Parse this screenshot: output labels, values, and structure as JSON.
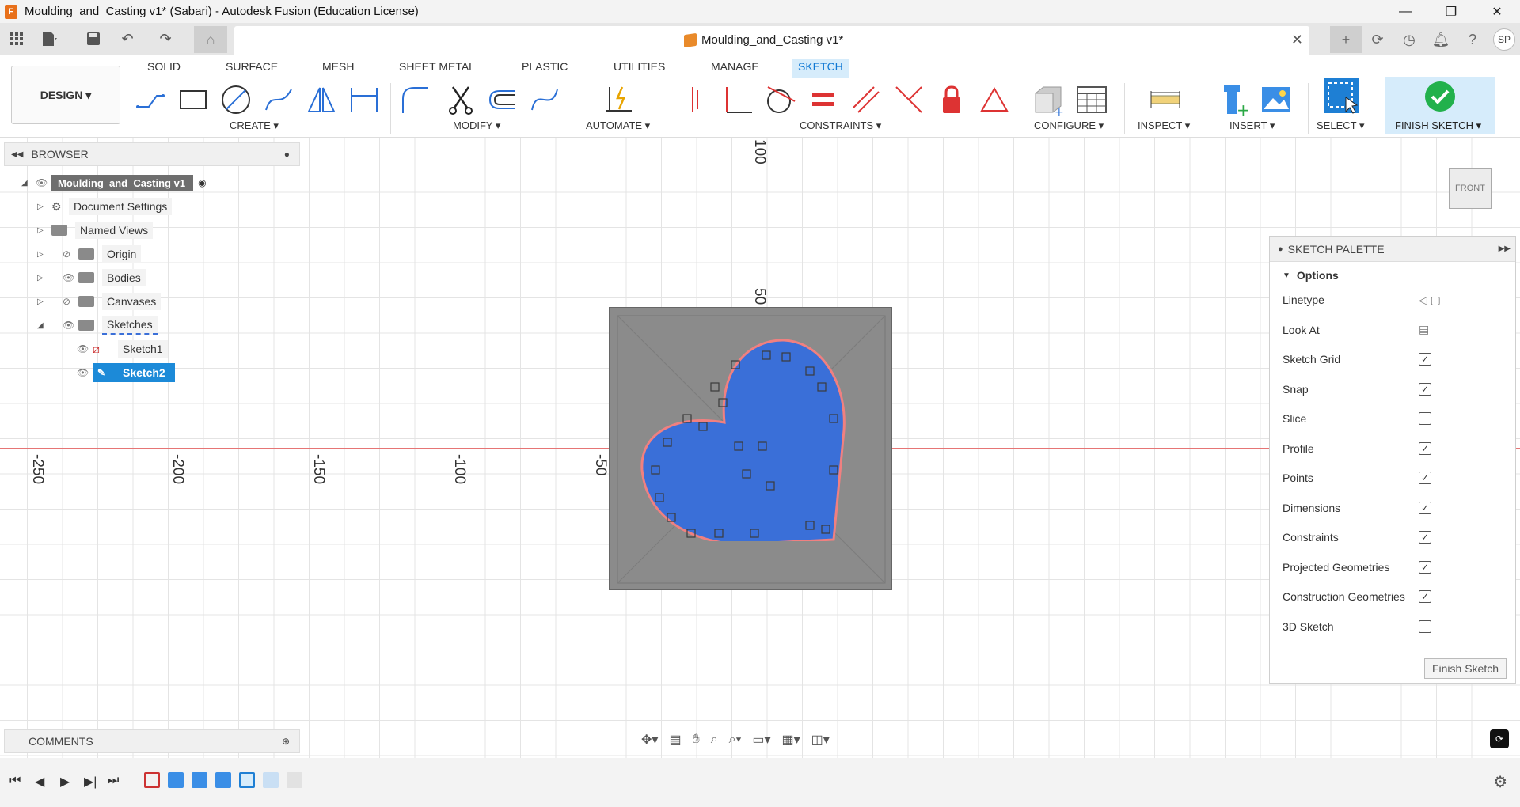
{
  "window": {
    "title": "Moulding_and_Casting v1* (Sabari) - Autodesk Fusion (Education License)",
    "logo_letter": "F",
    "controls": [
      "—",
      "❐",
      "✕"
    ]
  },
  "doc_tab": {
    "title": "Moulding_and_Casting v1*",
    "close": "✕",
    "user_initials": "SP"
  },
  "ribbon": {
    "workspace": "DESIGN ▾",
    "tabs": [
      "SOLID",
      "SURFACE",
      "MESH",
      "SHEET METAL",
      "PLASTIC",
      "UTILITIES",
      "MANAGE",
      "SKETCH"
    ],
    "groups": {
      "create": "CREATE ▾",
      "modify": "MODIFY ▾",
      "automate": "AUTOMATE ▾",
      "constraints": "CONSTRAINTS ▾",
      "configure": "CONFIGURE ▾",
      "inspect": "INSPECT ▾",
      "insert": "INSERT ▾",
      "select": "SELECT ▾",
      "finish": "FINISH SKETCH ▾"
    },
    "accent": "#0f78d4"
  },
  "browser": {
    "title": "BROWSER",
    "root": "Moulding_and_Casting v1",
    "items": [
      "Document Settings",
      "Named Views",
      "Origin",
      "Bodies",
      "Canvases",
      "Sketches",
      "Sketch1",
      "Sketch2"
    ]
  },
  "canvas": {
    "axis_labels": [
      "-250",
      "-200",
      "-150",
      "-100",
      "-50",
      "100",
      "50"
    ],
    "view_cube": "FRONT",
    "sketch_color": "#3a6fd8",
    "stock_color": "#8b8b8b"
  },
  "palette": {
    "title": "SKETCH PALETTE",
    "section": "Options",
    "rows": [
      {
        "label": "Linetype",
        "checked": null
      },
      {
        "label": "Look At",
        "checked": null
      },
      {
        "label": "Sketch Grid",
        "checked": true
      },
      {
        "label": "Snap",
        "checked": true
      },
      {
        "label": "Slice",
        "checked": false
      },
      {
        "label": "Profile",
        "checked": true
      },
      {
        "label": "Points",
        "checked": true
      },
      {
        "label": "Dimensions",
        "checked": true
      },
      {
        "label": "Constraints",
        "checked": true
      },
      {
        "label": "Projected Geometries",
        "checked": true
      },
      {
        "label": "Construction Geometries",
        "checked": true
      },
      {
        "label": "3D Sketch",
        "checked": false
      }
    ],
    "finish_button": "Finish Sketch"
  },
  "comments": {
    "title": "COMMENTS"
  }
}
